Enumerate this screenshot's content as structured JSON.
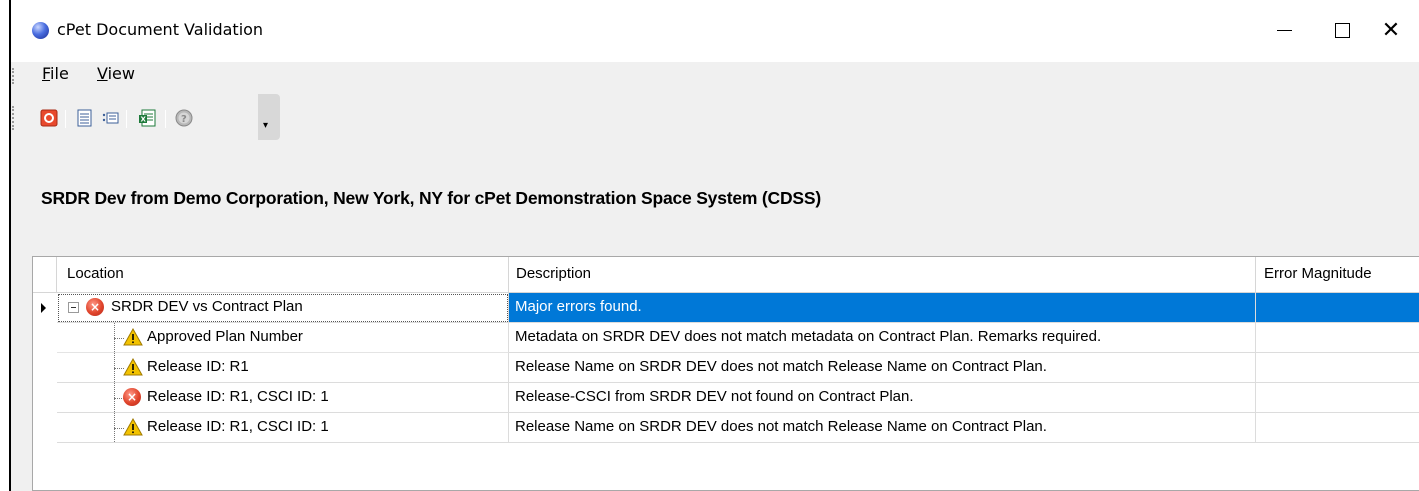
{
  "window": {
    "title": "cPet Document Validation",
    "close_glyph": "✕"
  },
  "menu": {
    "items": [
      {
        "label": "File",
        "accel": "F",
        "rest": "ile"
      },
      {
        "label": "View",
        "accel": "V",
        "rest": "iew"
      }
    ]
  },
  "toolbar": {
    "icons": [
      "stop-icon",
      "list-detail-icon",
      "list-icon",
      "excel-export-icon",
      "help-icon"
    ],
    "overflow_glyph": "▾"
  },
  "report": {
    "heading": "SRDR Dev from Demo Corporation, New York, NY for cPet Demonstration Space System (CDSS)"
  },
  "grid": {
    "columns": [
      "Location",
      "Description",
      "Error Magnitude"
    ],
    "rows": [
      {
        "level": 0,
        "icon": "error",
        "location": "SRDR DEV vs Contract Plan",
        "description": "Major errors found.",
        "magnitude": "",
        "selected": true
      },
      {
        "level": 1,
        "icon": "warning",
        "location": "Approved Plan Number",
        "description": "Metadata on SRDR DEV does not match metadata on Contract Plan.  Remarks required.",
        "magnitude": ""
      },
      {
        "level": 1,
        "icon": "warning",
        "location": "Release ID: R1",
        "description": "Release Name on SRDR DEV does not match Release Name on Contract Plan.",
        "magnitude": ""
      },
      {
        "level": 1,
        "icon": "error",
        "location": "Release ID: R1, CSCI ID: 1",
        "description": "Release-CSCI from SRDR DEV not found on Contract Plan.",
        "magnitude": ""
      },
      {
        "level": 1,
        "icon": "warning",
        "location": "Release ID: R1, CSCI ID: 1",
        "description": "Release Name on SRDR DEV does not match Release Name on Contract Plan.",
        "magnitude": ""
      }
    ]
  },
  "colors": {
    "selection": "#0078d7",
    "error": "#e0442b",
    "warning": "#f2c200"
  }
}
